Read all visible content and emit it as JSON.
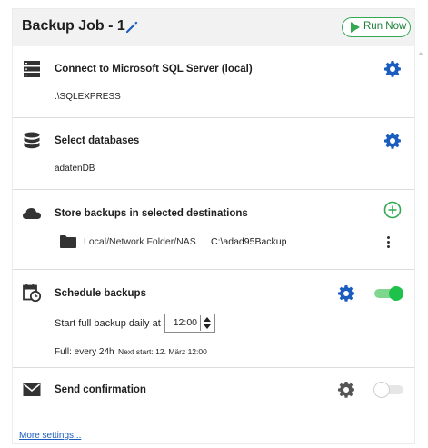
{
  "header": {
    "title": "Backup Job - 1",
    "run_label": "Run Now",
    "edit_icon": "pencil-icon",
    "run_icon": "play-icon"
  },
  "steps": {
    "connect": {
      "title": "Connect to Microsoft SQL Server (local)",
      "value": ".\\SQLEXPRESS",
      "icon": "server-icon"
    },
    "databases": {
      "title": "Select databases",
      "value": "adatenDB",
      "icon": "database-icon"
    },
    "destinations": {
      "title": "Store backups in selected destinations",
      "icon": "cloud-icon",
      "items": [
        {
          "type": "Local/Network Folder/NAS",
          "path": "C:\\adad95Backup",
          "icon": "folder-icon"
        }
      ]
    },
    "schedule": {
      "title": "Schedule backups",
      "icon": "calendar-clock-icon",
      "start_label": "Start full backup daily at",
      "time": "12:00",
      "full_label": "Full: every 24h",
      "next_start": "Next start: 12. März 12:00",
      "enabled": true
    },
    "confirmation": {
      "title": "Send confirmation",
      "icon": "envelope-icon",
      "enabled": false
    }
  },
  "footer": {
    "more_settings": "More settings..."
  },
  "colors": {
    "accent_blue": "#1a5dbf",
    "accent_green": "#34a853",
    "toggle_on": "#1ec24a"
  }
}
